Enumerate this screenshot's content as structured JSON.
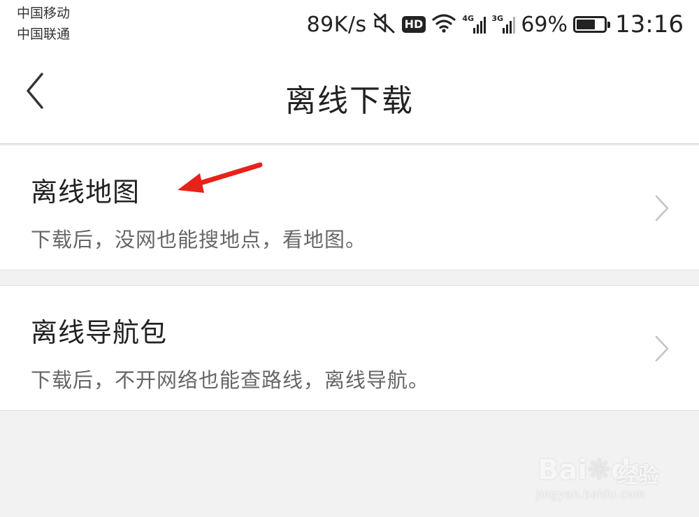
{
  "status_bar": {
    "carrier_1": "中国移动",
    "carrier_2": "中国联通",
    "net_speed": "89K/s",
    "sim1_tag": "4G",
    "sim2_tag": "3G",
    "battery_pct": "69%",
    "battery_level": 0.69,
    "time": "13:16",
    "hd_label": "HD",
    "icons": [
      "mute-icon",
      "hd-icon",
      "wifi-icon",
      "signal-4g-icon",
      "signal-3g-icon",
      "battery-icon"
    ]
  },
  "header": {
    "title": "离线下载",
    "back_icon": "chevron-left-icon"
  },
  "items": [
    {
      "title": "离线地图",
      "description": "下载后，没网也能搜地点，看地图。",
      "icon": "chevron-right-icon"
    },
    {
      "title": "离线导航包",
      "description": "下载后，不开网络也能查路线，离线导航。",
      "icon": "chevron-right-icon"
    }
  ],
  "annotation": {
    "arrow_color": "#e8211a"
  },
  "watermark": {
    "brand": "Bai",
    "brand_tail": "du",
    "product": "经验",
    "url": "jingyan.baidu.com"
  }
}
